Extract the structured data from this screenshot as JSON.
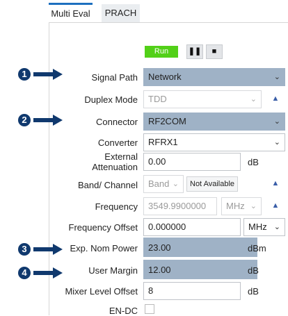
{
  "tabs": [
    {
      "label": "Multi Eval",
      "active": true
    },
    {
      "label": "PRACH",
      "active": false
    }
  ],
  "controls": {
    "run_label": "Run",
    "pause_icon": "pause-icon",
    "stop_icon": "stop-icon"
  },
  "fields": {
    "signal_path": {
      "label": "Signal Path",
      "value": "Network"
    },
    "duplex_mode": {
      "label": "Duplex Mode",
      "value": "TDD"
    },
    "connector": {
      "label": "Connector",
      "value": "RF2COM"
    },
    "converter": {
      "label": "Converter",
      "value": "RFRX1"
    },
    "external_attenuation": {
      "label_line1": "External",
      "label_line2": "Attenuation",
      "value": "0.00",
      "unit": "dB"
    },
    "band_channel": {
      "label": "Band/ Channel",
      "value": "Band",
      "status": "Not Available"
    },
    "frequency": {
      "label": "Frequency",
      "value": "3549.9900000",
      "unit": "MHz"
    },
    "frequency_offset": {
      "label": "Frequency Offset",
      "value": "0.000000",
      "unit": "MHz"
    },
    "exp_nom_power": {
      "label": "Exp. Nom Power",
      "value": "23.00",
      "unit": "dBm"
    },
    "user_margin": {
      "label": "User Margin",
      "value": "12.00",
      "unit": "dB"
    },
    "mixer_level_offset": {
      "label": "Mixer Level Offset",
      "value": "8",
      "unit": "dB"
    },
    "en_dc": {
      "label": "EN-DC",
      "checked": false
    }
  },
  "callouts": [
    "1",
    "2",
    "3",
    "4"
  ],
  "colors": {
    "accent": "#1d6fbf",
    "run": "#52d018",
    "highlight": "#9fb2c6",
    "callout": "#10396e"
  }
}
